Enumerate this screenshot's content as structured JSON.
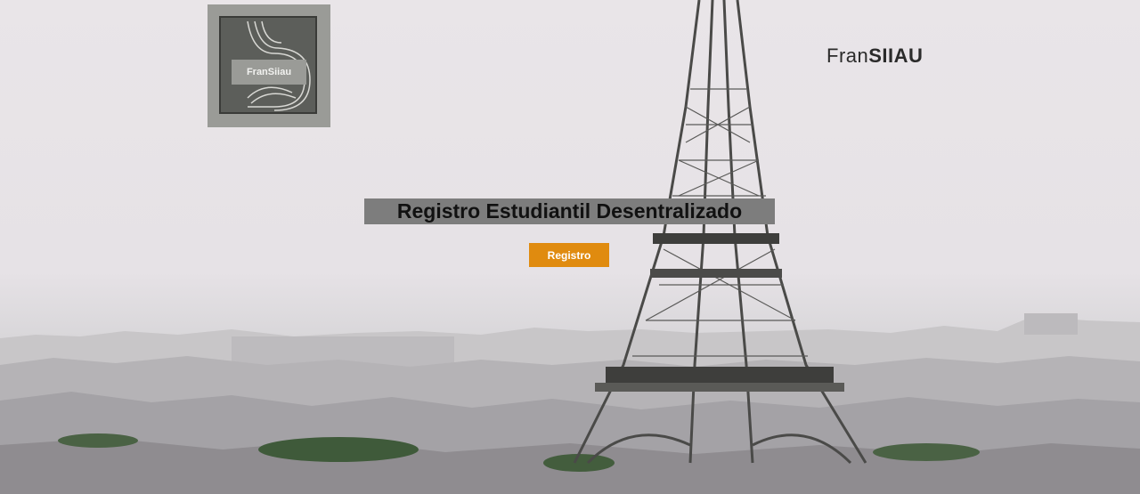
{
  "logo": {
    "text": "FranSiiau"
  },
  "brand": {
    "prefix": "Fran",
    "suffix": "SIIAU"
  },
  "hero": {
    "title": "Registro Estudiantil Desentralizado"
  },
  "cta": {
    "label": "Registro"
  },
  "colors": {
    "cta": "#e08b0f",
    "title_bg": "#7d7d7d",
    "logo_bg": "#9a9b97"
  }
}
